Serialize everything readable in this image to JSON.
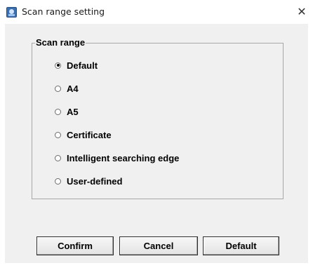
{
  "window": {
    "title": "Scan range setting",
    "close_glyph": "✕"
  },
  "group": {
    "label": "Scan range",
    "options": [
      {
        "label": "Default",
        "checked": true
      },
      {
        "label": "A4",
        "checked": false
      },
      {
        "label": "A5",
        "checked": false
      },
      {
        "label": "Certificate",
        "checked": false
      },
      {
        "label": "Intelligent searching edge",
        "checked": false
      },
      {
        "label": "User-defined",
        "checked": false
      }
    ]
  },
  "buttons": {
    "confirm": "Confirm",
    "cancel": "Cancel",
    "default": "Default"
  }
}
